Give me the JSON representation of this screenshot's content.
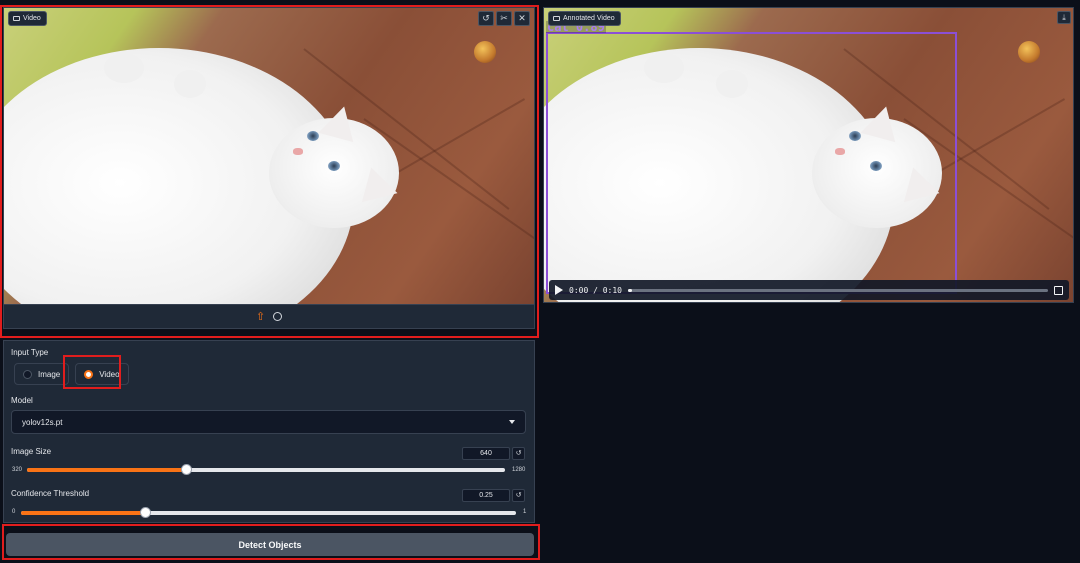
{
  "input_panel": {
    "label": "Video",
    "toolbar_icons": [
      "undo-icon",
      "scissors-icon",
      "close-icon"
    ],
    "bottom_icons": [
      "upload-icon",
      "webcam-icon"
    ]
  },
  "output_panel": {
    "label": "Annotated Video",
    "detection_label": "cat 0.89",
    "time_display": "0:00 / 0:10",
    "progress": 0.0
  },
  "input_type": {
    "label": "Input Type",
    "options": [
      "Image",
      "Video"
    ],
    "selected": "Video"
  },
  "model": {
    "label": "Model",
    "value": "yolov12s.pt"
  },
  "image_size": {
    "label": "Image Size",
    "value": "640",
    "min": "320",
    "max": "1280",
    "level": 0.333
  },
  "confidence": {
    "label": "Confidence Threshold",
    "value": "0.25",
    "min": "0",
    "max": "1",
    "level": 0.25
  },
  "detect_button": {
    "label": "Detect Objects"
  },
  "colors": {
    "accent": "#f97316",
    "highlight": "#e11d1d",
    "bbox": "#8b4fd6"
  }
}
